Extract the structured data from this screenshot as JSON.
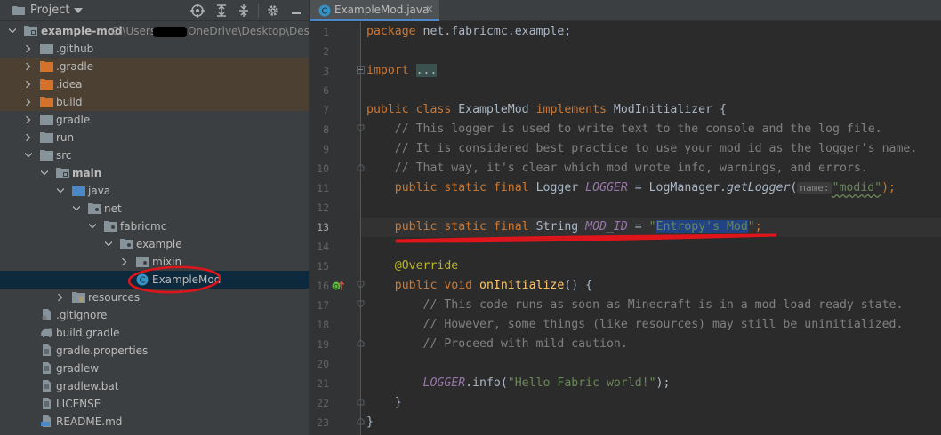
{
  "project_panel": {
    "title": "Project",
    "tree": [
      {
        "label": "example-mod",
        "path": " C:\\Users\\",
        "path2": "OneDrive\\Desktop\\Deskto",
        "bold": true
      },
      {
        "label": ".github"
      },
      {
        "label": ".gradle"
      },
      {
        "label": ".idea"
      },
      {
        "label": "build"
      },
      {
        "label": "gradle"
      },
      {
        "label": "run"
      },
      {
        "label": "src"
      },
      {
        "label": "main",
        "bold": true
      },
      {
        "label": "java"
      },
      {
        "label": "net"
      },
      {
        "label": "fabricmc"
      },
      {
        "label": "example"
      },
      {
        "label": "mixin"
      },
      {
        "label": "ExampleMod"
      },
      {
        "label": "resources"
      },
      {
        "label": ".gitignore"
      },
      {
        "label": "build.gradle"
      },
      {
        "label": "gradle.properties"
      },
      {
        "label": "gradlew"
      },
      {
        "label": "gradlew.bat"
      },
      {
        "label": "LICENSE"
      },
      {
        "label": "README.md"
      }
    ]
  },
  "editor": {
    "tab_label": "ExampleMod.java",
    "tab_close": "×",
    "line_numbers": [
      "1",
      "2",
      "3",
      "6",
      "7",
      "8",
      "9",
      "10",
      "11",
      "12",
      "13",
      "14",
      "15",
      "16",
      "17",
      "18",
      "19",
      "20",
      "21",
      "22",
      "23"
    ],
    "current_line": "13",
    "code": {
      "l1_kw": "package",
      "l1_rest": " net.fabricmc.example;",
      "l3_kw": "import",
      "l3_fold": "...",
      "l7_kw1": "public class",
      "l7_name": " ExampleMod ",
      "l7_kw2": "implements",
      "l7_rest": " ModInitializer {",
      "l8": "    // This logger is used to write text to the console and the log file.",
      "l9": "    // It is considered best practice to use your mod id as the logger's name.",
      "l10": "    // That way, it's clear which mod wrote info, warnings, and errors.",
      "l11_kw": "    public static final",
      "l11_type": " Logger ",
      "l11_field": "LOGGER",
      "l11_mid": " = LogManager.",
      "l11_method": "getLogger",
      "l11_paren": "(",
      "l11_hint": "name:",
      "l11_str": "\"modid\"",
      "l11_end": ");",
      "l13_kw": "    public static final",
      "l13_type": " String ",
      "l13_field": "MOD_ID",
      "l13_eq": " = ",
      "l13_q1": "\"",
      "l13_sel": "Entropy's Mod",
      "l13_q2": "\"",
      "l13_end": ";",
      "l15": "    @Override",
      "l16_kw": "    public void",
      "l16_method": " onInitialize",
      "l16_rest": "() {",
      "l17": "        // This code runs as soon as Minecraft is in a mod-load-ready state.",
      "l18": "        // However, some things (like resources) may still be uninitialized.",
      "l19": "        // Proceed with mild caution.",
      "l21_field": "        LOGGER",
      "l21_mid": ".info(",
      "l21_str": "\"Hello Fabric world!\"",
      "l21_end": ");",
      "l22": "    }",
      "l23": "}"
    }
  },
  "colors": {
    "annotation": "#e0151b"
  },
  "icons": [
    "project-folder-icon",
    "target-icon",
    "expand-all-icon",
    "collapse-all-icon",
    "gear-icon",
    "minimize-icon",
    "class-icon",
    "fold-icon",
    "override-gutter-icon"
  ]
}
